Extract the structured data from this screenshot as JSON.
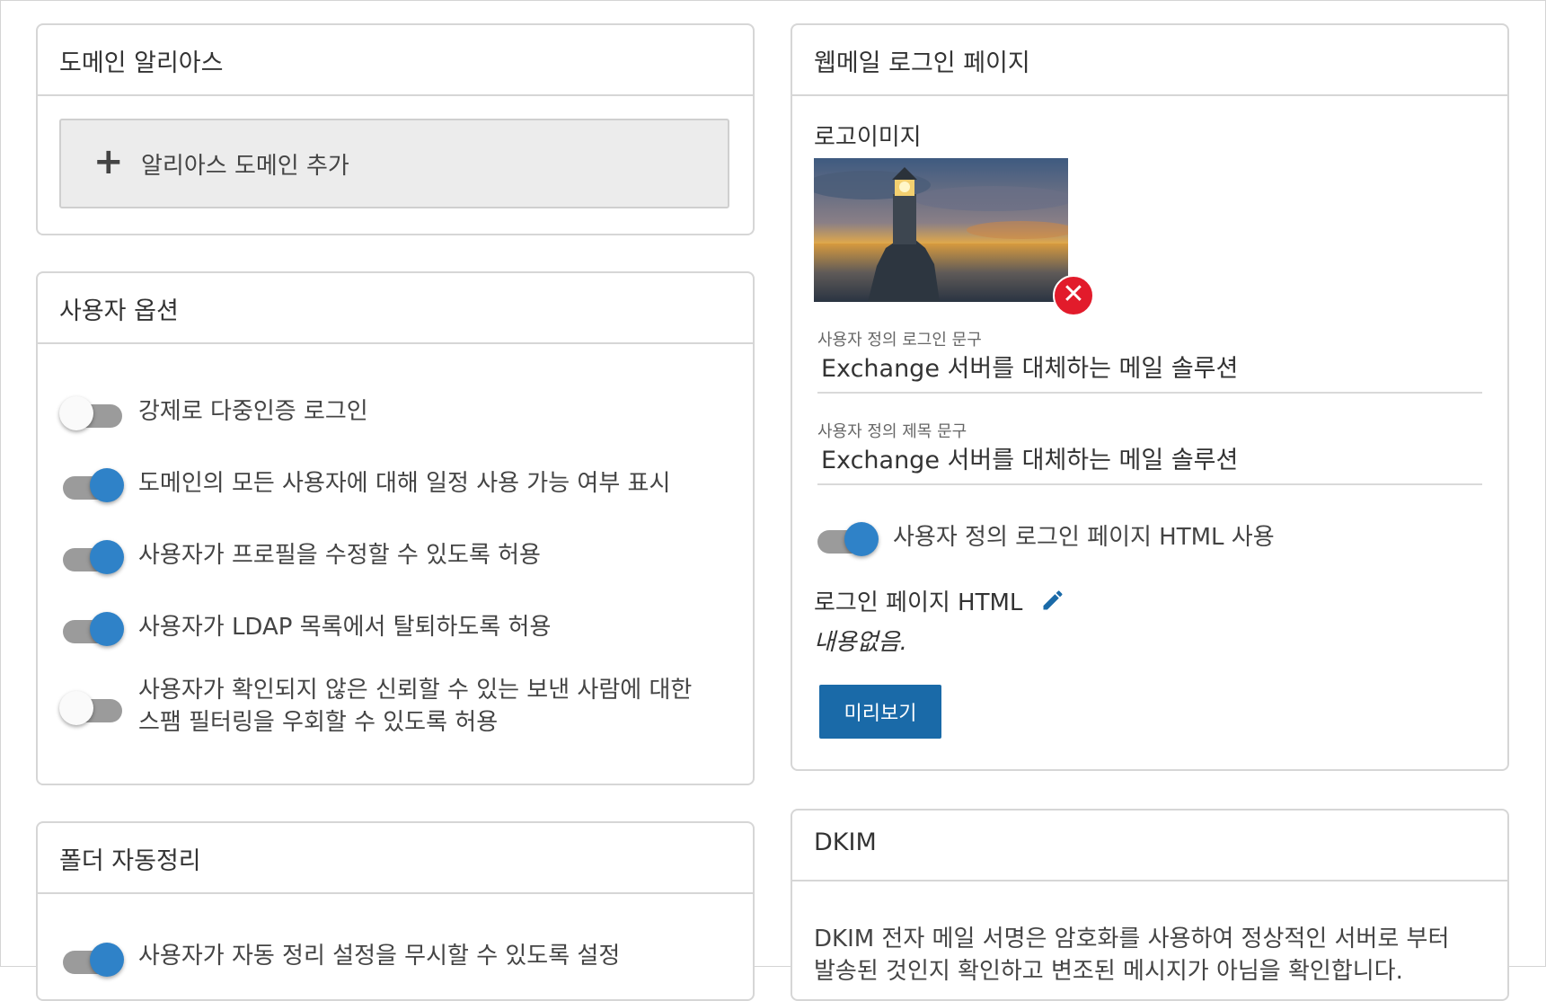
{
  "domain_alias": {
    "title": "도메인 알리아스",
    "add_label": "알리아스 도메인 추가",
    "add_icon": "plus-icon"
  },
  "user_options": {
    "title": "사용자 옵션",
    "items": [
      {
        "label": "강제로 다중인증 로그인",
        "on": false
      },
      {
        "label": "도메인의 모든 사용자에 대해 일정 사용 가능 여부 표시",
        "on": true
      },
      {
        "label": "사용자가 프로필을 수정할 수 있도록 허용",
        "on": true
      },
      {
        "label": "사용자가 LDAP 목록에서 탈퇴하도록 허용",
        "on": true
      },
      {
        "label_line1": "사용자가 확인되지 않은 신뢰할 수 있는 보낸 사람에 대한",
        "label_line2": "스팸 필터링을 우회할 수 있도록 허용",
        "on": false
      }
    ]
  },
  "folder_cleanup": {
    "title": "폴더 자동정리",
    "item_label": "사용자가 자동 정리 설정을 무시할 수 있도록 설정"
  },
  "webmail_login": {
    "title": "웹메일 로그인 페이지",
    "logo_label": "로고이미지",
    "remove_icon": "close-icon",
    "custom_login_text_label": "사용자 정의 로그인 문구",
    "custom_login_text_value": "Exchange 서버를 대체하는 메일 솔루션",
    "custom_title_text_label": "사용자 정의 제목 문구",
    "custom_title_text_value": "Exchange 서버를 대체하는 메일 솔루션",
    "custom_html_toggle_label": "사용자 정의 로그인 페이지 HTML 사용",
    "custom_html_toggle_on": true,
    "login_html_label": "로그인 페이지 HTML",
    "edit_icon": "pencil-icon",
    "login_html_value": "내용없음.",
    "preview_button": "미리보기"
  },
  "dkim": {
    "title": "DKIM",
    "desc_line1": "DKIM 전자 메일 서명은 암호화를 사용하여 정상적인 서버로 부터",
    "desc_line2": "발송된 것인지 확인하고 변조된 메시지가 아님을 확인합니다."
  },
  "colors": {
    "toggle_on": "#2f82c8",
    "toggle_track": "#9b9b9b",
    "remove_red": "#e21b2b",
    "preview_blue": "#1a6aa8",
    "edit_icon": "#1a6aa8"
  }
}
